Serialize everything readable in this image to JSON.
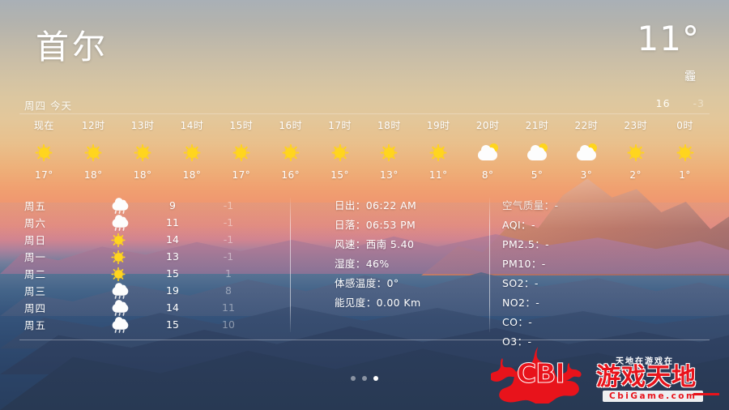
{
  "header": {
    "city": "首尔",
    "current_temp": "11°",
    "condition": "霾",
    "today_label": "周四 今天",
    "high": "16",
    "low": "-3"
  },
  "hourly": [
    {
      "label": "现在",
      "icon": "sun-icon",
      "temp": "17°"
    },
    {
      "label": "12时",
      "icon": "sun-icon",
      "temp": "18°"
    },
    {
      "label": "13时",
      "icon": "sun-icon",
      "temp": "18°"
    },
    {
      "label": "14时",
      "icon": "sun-icon",
      "temp": "18°"
    },
    {
      "label": "15时",
      "icon": "sun-icon",
      "temp": "17°"
    },
    {
      "label": "16时",
      "icon": "sun-icon",
      "temp": "16°"
    },
    {
      "label": "17时",
      "icon": "sun-icon",
      "temp": "15°"
    },
    {
      "label": "18时",
      "icon": "sun-icon",
      "temp": "13°"
    },
    {
      "label": "19时",
      "icon": "sun-icon",
      "temp": "11°"
    },
    {
      "label": "20时",
      "icon": "partly-cloudy-icon",
      "temp": "8°"
    },
    {
      "label": "21时",
      "icon": "partly-cloudy-icon",
      "temp": "5°"
    },
    {
      "label": "22时",
      "icon": "partly-cloudy-icon",
      "temp": "3°"
    },
    {
      "label": "23时",
      "icon": "sun-icon",
      "temp": "2°"
    },
    {
      "label": "0时",
      "icon": "sun-icon",
      "temp": "1°"
    }
  ],
  "daily": [
    {
      "name": "周五",
      "icon": "rain-icon",
      "high": "9",
      "low": "-1"
    },
    {
      "name": "周六",
      "icon": "rain-icon",
      "high": "11",
      "low": "-1"
    },
    {
      "name": "周日",
      "icon": "sun-icon",
      "high": "14",
      "low": "-1"
    },
    {
      "name": "周一",
      "icon": "sun-icon",
      "high": "13",
      "low": "-1"
    },
    {
      "name": "周二",
      "icon": "sun-icon",
      "high": "15",
      "low": "1"
    },
    {
      "name": "周三",
      "icon": "rain-icon",
      "high": "19",
      "low": "8"
    },
    {
      "name": "周四",
      "icon": "rain-icon",
      "high": "14",
      "low": "11"
    },
    {
      "name": "周五",
      "icon": "rain-icon",
      "high": "15",
      "low": "10"
    }
  ],
  "details": {
    "sunrise": "日出：06:22 AM",
    "sunset": "日落：06:53 PM",
    "wind": "风速：西南 5.40",
    "humidity": "湿度：46%",
    "feels_like": "体感温度：0°",
    "visibility": "能见度：0.00 Km"
  },
  "air_quality": {
    "title": "空气质量：-",
    "aqi": "AQI：-",
    "pm25": "PM2.5：-",
    "pm10": "PM10：-",
    "so2": "SO2：-",
    "no2": "NO2：-",
    "co": "CO：-",
    "o3": "O3：-"
  },
  "pager": {
    "count": 3,
    "active_index": 2
  },
  "watermark": {
    "brand": "CBI",
    "brand_cn": "游戏天地",
    "tagline": "天地在游戏在",
    "url": "CbiGame.com"
  },
  "colors": {
    "accent_sun": "#ffd51e",
    "text": "#ffffff",
    "watermark_red": "#e8131b"
  }
}
